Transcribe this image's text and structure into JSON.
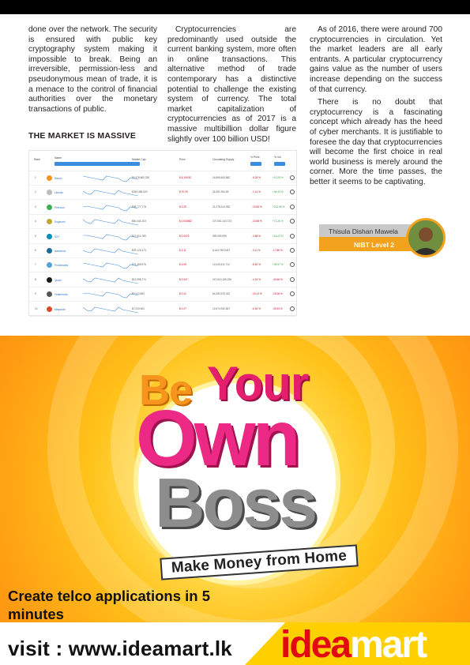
{
  "article": {
    "col1": [
      "done over the network. The security is ensured with public key cryptography system making it impossible to break. Being an irreversible, permission-less and pseudonymous mean of trade, it is a menace to the control of financial authorities over the monetary transactions of public."
    ],
    "heading": "THE MARKET IS MASSIVE",
    "col2": [
      "Cryptocurrencies are predominantly used outside the current banking system, more often in online transactions. This alternative method of trade contemporary has a distinctive potential to challenge the existing system of currency. The total market capitalization of cryptocurrencies as of 2017 is a massive multibillion dollar figure slightly over 100 billion USD!"
    ],
    "col3": [
      "As of 2016, there were around 700 cryptocurrencies in circulation. Yet the market leaders are all early entrants. A particular cryptocurrency gains value as the number of users increase depending on the success of that currency.",
      "There is no doubt that cryptocurrency is a fascinating concept which already has the heed of cyber merchants. It is justifiable to foresee the day that cryptocurrencies will become the first choice in real world business is merely around the corner. More the time passes, the better it seems to be captivating."
    ]
  },
  "table": {
    "headers": {
      "rank": "Rank",
      "name": "Name",
      "market_cap": "Market Cap",
      "price": "Price",
      "supply": "Circulating Supply",
      "change": "% Price",
      "pct": "% Vol"
    },
    "rows": [
      {
        "rank": "1",
        "name": "Bitcoin",
        "cap": "$6,478,662,330",
        "price": "$ 6,105.92",
        "supply": "16,565,643,862",
        "change": "-5.25 %",
        "pct": "+10.28 %",
        "color": "#f7931a"
      },
      {
        "rank": "2",
        "name": "Litecoin",
        "cap": "$349,465,520",
        "price": "$ 70.09",
        "supply": "26,491,394.59",
        "change": "-1.41 %",
        "pct": "+44.43 %",
        "color": "#bfbbbb"
      },
      {
        "rank": "3",
        "name": "Peercoin",
        "cap": "$68,777,778",
        "price": "$ 3.29",
        "supply": "21,278,314,992",
        "change": "-10.65 %",
        "pct": "+221.96 %",
        "color": "#3cb054"
      },
      {
        "rank": "4",
        "name": "Dogecoin",
        "cap": "$60,444,103",
        "price": "$ 0.000562",
        "supply": "107,551,143,723",
        "change": "-10.58 %",
        "pct": "+71.26 %",
        "color": "#c2a633"
      },
      {
        "rank": "5",
        "name": "NXT",
        "cap": "$47,614,789",
        "price": "$ 0.0476",
        "supply": "999,999,999",
        "change": "-3.68 %",
        "pct": "+16.22 %",
        "color": "#008fbb"
      },
      {
        "rank": "6",
        "name": "Namecoin",
        "cap": "$29,176,473",
        "price": "$ 2.11",
        "supply": "8,144,759,9447",
        "change": "-3.11 %",
        "pct": "-17.86 %",
        "color": "#186c9d"
      },
      {
        "rank": "7",
        "name": "Protoshares",
        "cap": "$24,469,976",
        "price": "$ 1.09",
        "supply": "12,049,411,712",
        "change": "-8.82 %",
        "pct": "+26.97 %",
        "color": "#54a2d8"
      },
      {
        "rank": "8",
        "name": "Quark",
        "cap": "$12,598,774",
        "price": "$ 0.047",
        "supply": "247,610,159,226",
        "change": "-4.15 %",
        "pct": "-40.66 %",
        "color": "#1a1a1a"
      },
      {
        "rank": "9",
        "name": "Feathercoin",
        "cap": "$9,413,692",
        "price": "$ 0.41",
        "supply": "64,282,679,312",
        "change": "-15.13 %",
        "pct": "-15.08 %",
        "color": "#555"
      },
      {
        "rank": "10",
        "name": "Megacoin",
        "cap": "$7,243,902",
        "price": "$ 0.27",
        "supply": "22,574,932,657",
        "change": "-6.54 %",
        "pct": "-35.93 %",
        "color": "#d94b2b"
      }
    ]
  },
  "author": {
    "name": "Thisula Dishan Mawela",
    "level": "NIBT Level 2"
  },
  "ad": {
    "be": "Be",
    "your": "Your",
    "own": "Own",
    "boss": "Boss",
    "tagline": "Make Money from Home",
    "telco": "Create telco applications in 5 minutes",
    "visit": "visit : www.ideamart.lk",
    "logo_part1": "idea",
    "logo_part2": "mart"
  }
}
